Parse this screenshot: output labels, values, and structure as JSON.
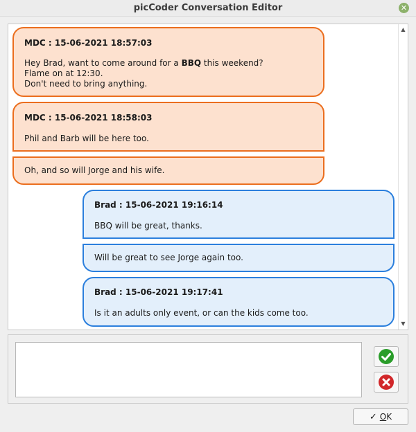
{
  "window": {
    "title": "picCoder Conversation Editor",
    "close_symbol": "✕"
  },
  "conversation": [
    {
      "sender": "MDC : 15-06-2021 18:57:03",
      "lines": [
        "Hey Brad, want to come around for a ",
        "BBQ",
        " this weekend?",
        "Flame on at 12:30.",
        "Don't need to bring anything."
      ]
    },
    {
      "sender": "MDC : 15-06-2021 18:58:03",
      "lines": [
        "Phil and Barb will be here too."
      ]
    },
    {
      "sender": "",
      "lines": [
        "Oh, and so will Jorge and his wife."
      ]
    },
    {
      "sender": "Brad : 15-06-2021 19:16:14",
      "lines": [
        "BBQ will be great, thanks."
      ]
    },
    {
      "sender": "",
      "lines": [
        "Will be great to see Jorge again too."
      ]
    },
    {
      "sender": "Brad : 15-06-2021 19:17:41",
      "lines": [
        "Is it an adults only event, or can the kids come too."
      ]
    }
  ],
  "editor": {
    "input_value": "",
    "ok_label": "OK",
    "ok_mnemonic": "O",
    "ok_rest": "K"
  },
  "icons": {
    "accept": "checkmark-circle-icon",
    "reject": "close-circle-icon"
  },
  "colors": {
    "mdc_bubble": "#fde1cf",
    "mdc_border": "#eb6e1e",
    "brad_bubble": "#e3effb",
    "brad_border": "#2b7fdd",
    "accept": "#2a9d2a",
    "reject": "#d1272a"
  }
}
